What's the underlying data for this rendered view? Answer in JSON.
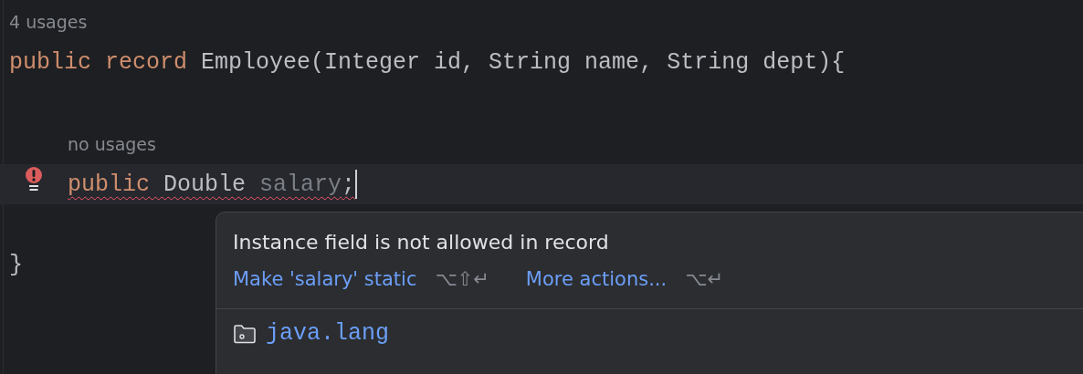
{
  "code": {
    "hint": "4 usages",
    "tokens": [
      {
        "text": "public record ",
        "kind": "keyword"
      },
      {
        "text": "Employee(Integer id, String name, String dept){",
        "kind": "plain"
      }
    ],
    "children": [
      {
        "hint": "no usages",
        "error": true,
        "current": true,
        "caret": true,
        "tokens": [
          {
            "text": "public ",
            "kind": "keyword"
          },
          {
            "text": "Double ",
            "kind": "plain"
          },
          {
            "text": "salary",
            "kind": "unused"
          },
          {
            "text": ";",
            "kind": "plain"
          }
        ]
      }
    ],
    "closing": "}"
  },
  "popup": {
    "message": "Instance field is not allowed in record",
    "actions": [
      {
        "label": "Make 'salary' static",
        "shortcut": "⌥⇧↵"
      },
      {
        "label": "More actions...",
        "shortcut": "⌥↵"
      }
    ],
    "package": "java.lang"
  }
}
